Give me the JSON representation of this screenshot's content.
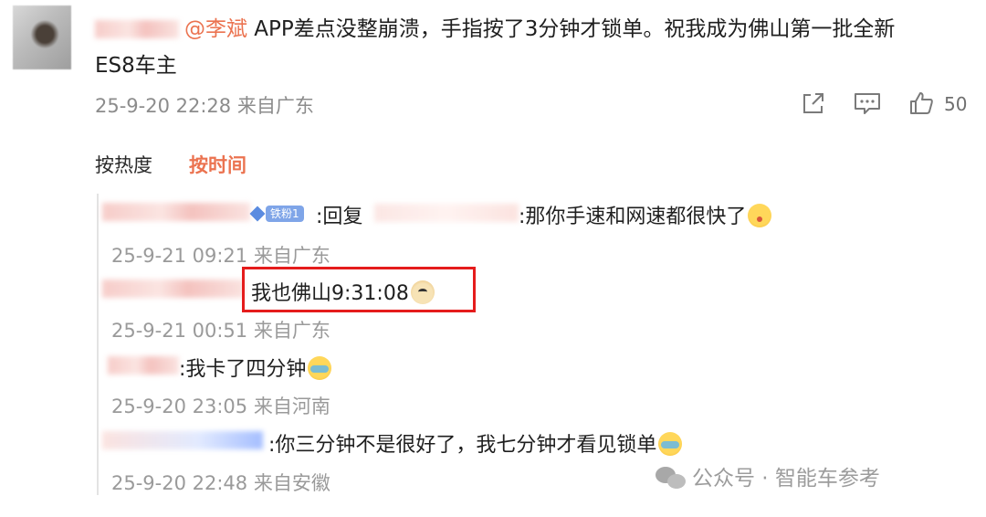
{
  "comment": {
    "mention": "@李斌",
    "text_line1": " APP差点没整崩溃，手指按了3分钟才锁单。祝我成为佛山第一批全新",
    "text_line2": "ES8车主",
    "timestamp": "25-9-20 22:28 来自广东",
    "like_count": "50",
    "icons": [
      "share-icon",
      "comment-icon",
      "like-icon"
    ]
  },
  "sort_tabs": {
    "by_hot": "按热度",
    "by_time": "按时间",
    "active": "by_time"
  },
  "replies": [
    {
      "badge": "铁粉1",
      "reply_word": ":回复",
      "text": ":那你手速和网速都很快了",
      "emoji": "kiss-emoji",
      "meta": "25-9-21 09:21 来自广东"
    },
    {
      "text": "我也佛山9:31:08",
      "emoji": "dog-emoji",
      "meta": "25-9-21 00:51 来自广东"
    },
    {
      "text": ":我卡了四分钟",
      "emoji": "cry-emoji",
      "meta": "25-9-20 23:05 来自河南"
    },
    {
      "text": ":你三分钟不是很好了，我七分钟才看见锁单",
      "emoji": "cry-emoji",
      "meta": "25-9-20 22:48 来自安徽"
    }
  ],
  "watermark": "公众号 · 智能车参考",
  "colors": {
    "accent": "#eb7350",
    "highlight_box": "#e51c1c",
    "meta_gray": "#8c8c8c"
  }
}
